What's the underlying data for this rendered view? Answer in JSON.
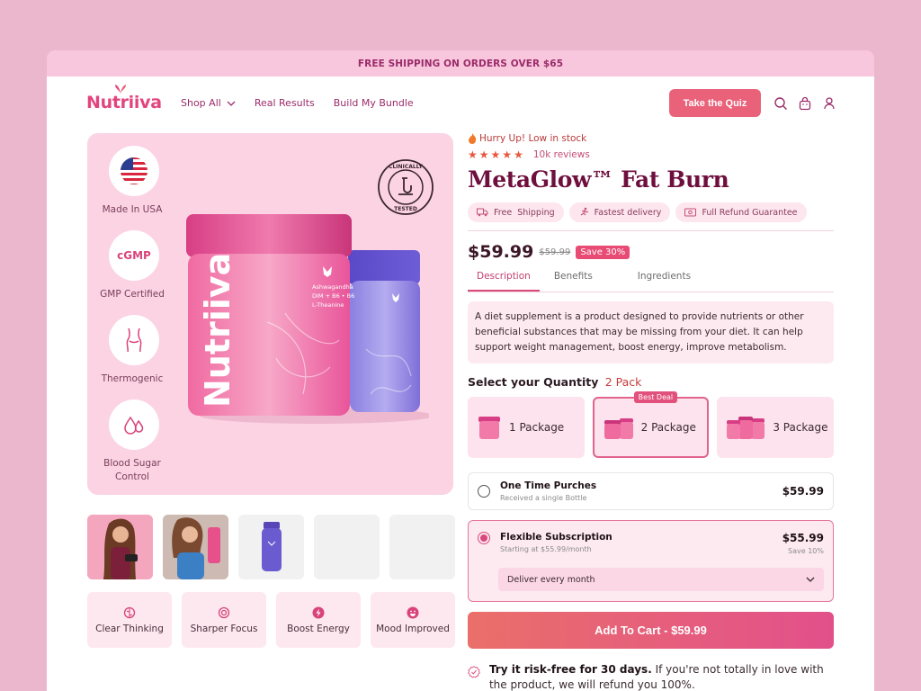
{
  "banner": {
    "text": "FREE SHIPPING ON ORDERS OVER $65"
  },
  "brand": {
    "name": "Nutriiva"
  },
  "nav": {
    "items": [
      "Shop All",
      "Real Results",
      "Build My Bundle"
    ],
    "quiz_label": "Take the Quiz"
  },
  "hero": {
    "badges": [
      {
        "label": "Made In USA",
        "icon": "usa-flag-icon"
      },
      {
        "label": "GMP Certified",
        "icon_text": "cGMP"
      },
      {
        "label": "Thermogenic",
        "icon": "body-icon"
      },
      {
        "label": "Blood Sugar Control",
        "icon": "drops-icon"
      }
    ],
    "stamp": {
      "top": "CLINICALLY",
      "bottom": "TESTED"
    },
    "jar_brand": "Nutriiva",
    "jar_ingredients": [
      "Ashwagandha",
      "DIM + B6 • B6",
      "L-Theanine"
    ]
  },
  "benefits": [
    "Clear Thinking",
    "Sharper Focus",
    "Boost Energy",
    "Mood Improved"
  ],
  "product": {
    "urgency": "Hurry Up! Low in stock",
    "rating_stars": 5,
    "reviews": "10k reviews",
    "title": "MetaGlow™ Fat Burn",
    "chips": [
      "Free  Shipping",
      "Fastest delivery",
      "Full Refund Guarantee"
    ],
    "price": "$59.99",
    "old_price": "$59.99",
    "save_badge": "Save 30%",
    "tabs": [
      "Description",
      "Benefits",
      "Ingredients"
    ],
    "description": "A diet supplement is a product designed to provide nutrients or other beneficial substances that may be missing from your diet. It can help support weight management, boost energy, improve metabolism.",
    "quantity_label": "Select your Quantity",
    "quantity_selected": "2 Pack",
    "packages": [
      {
        "label": "1 Package"
      },
      {
        "label": "2 Package",
        "badge": "Best Deal"
      },
      {
        "label": "3 Package"
      }
    ],
    "one_time": {
      "title": "One Time Purches",
      "sub": "Received a single Bottle",
      "price": "$59.99"
    },
    "subscription": {
      "title": "Flexible Subscription",
      "sub": "Starting at $55.99/month",
      "price": "$55.99",
      "save": "Save 10%",
      "deliver": "Deliver every month"
    },
    "cart_label": "Add To Cart - $59.99",
    "guarantee_bold": "Try it risk-free for 30 days.",
    "guarantee_text": " If you're not totally in love with the product, we will refund you 100%."
  },
  "colors": {
    "accent": "#e2457d",
    "banner_bg": "#f8c6dd",
    "hero_bg": "#fbd3e3",
    "title": "#6e0f3e"
  }
}
